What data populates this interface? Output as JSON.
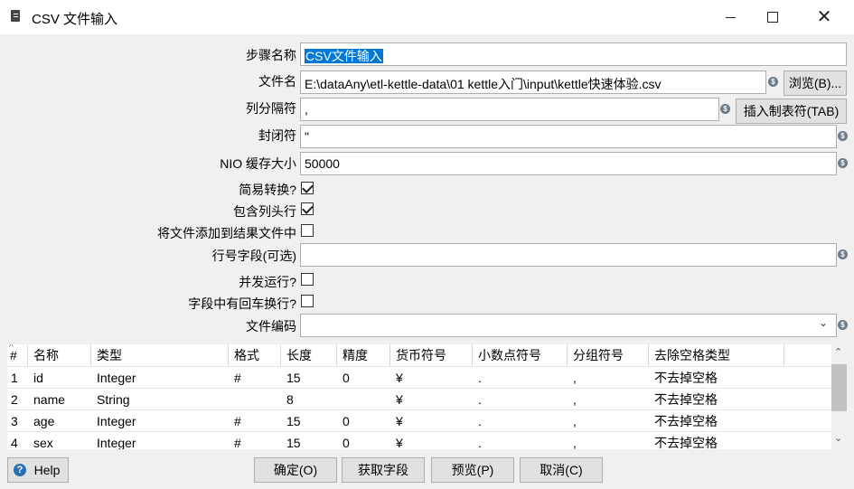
{
  "window": {
    "title": "CSV 文件输入"
  },
  "form": {
    "step_name_label": "步骤名称",
    "step_name_value": "CSV文件输入",
    "filename_label": "文件名",
    "filename_value": "E:\\dataAny\\etl-kettle-data\\01 kettle入门\\input\\kettle快速体验.csv",
    "browse_button": "浏览(B)...",
    "delimiter_label": "列分隔符",
    "delimiter_value": ",",
    "insert_tab_button": "插入制表符(TAB)",
    "enclosure_label": "封闭符",
    "enclosure_value": "\"",
    "nio_label": "NIO 缓存大小",
    "nio_value": "50000",
    "lazy_label": "简易转换?",
    "lazy_checked": true,
    "header_label": "包含列头行",
    "header_checked": true,
    "add_result_label": "将文件添加到结果文件中",
    "add_result_checked": false,
    "rownum_label": "行号字段(可选)",
    "rownum_value": "",
    "parallel_label": "并发运行?",
    "parallel_checked": false,
    "newline_label": "字段中有回车换行?",
    "newline_checked": false,
    "encoding_label": "文件编码",
    "encoding_value": ""
  },
  "table": {
    "columns": [
      "#",
      "名称",
      "类型",
      "格式",
      "长度",
      "精度",
      "货币符号",
      "小数点符号",
      "分组符号",
      "去除空格类型"
    ],
    "rows": [
      [
        "1",
        "id",
        "Integer",
        "#",
        "15",
        "0",
        "¥",
        ".",
        ",",
        "不去掉空格"
      ],
      [
        "2",
        "name",
        "String",
        "",
        "8",
        "",
        "¥",
        ".",
        ",",
        "不去掉空格"
      ],
      [
        "3",
        "age",
        "Integer",
        "#",
        "15",
        "0",
        "¥",
        ".",
        ",",
        "不去掉空格"
      ],
      [
        "4",
        "sex",
        "Integer",
        "#",
        "15",
        "0",
        "¥",
        ".",
        ",",
        "不去掉空格"
      ]
    ]
  },
  "footer": {
    "help": "Help",
    "ok": "确定(O)",
    "get_fields": "获取字段",
    "preview": "预览(P)",
    "cancel": "取消(C)"
  },
  "colors": {
    "selection": "#0078d7",
    "window_bg": "#f0f0f0",
    "button_bg": "#e1e1e1"
  }
}
